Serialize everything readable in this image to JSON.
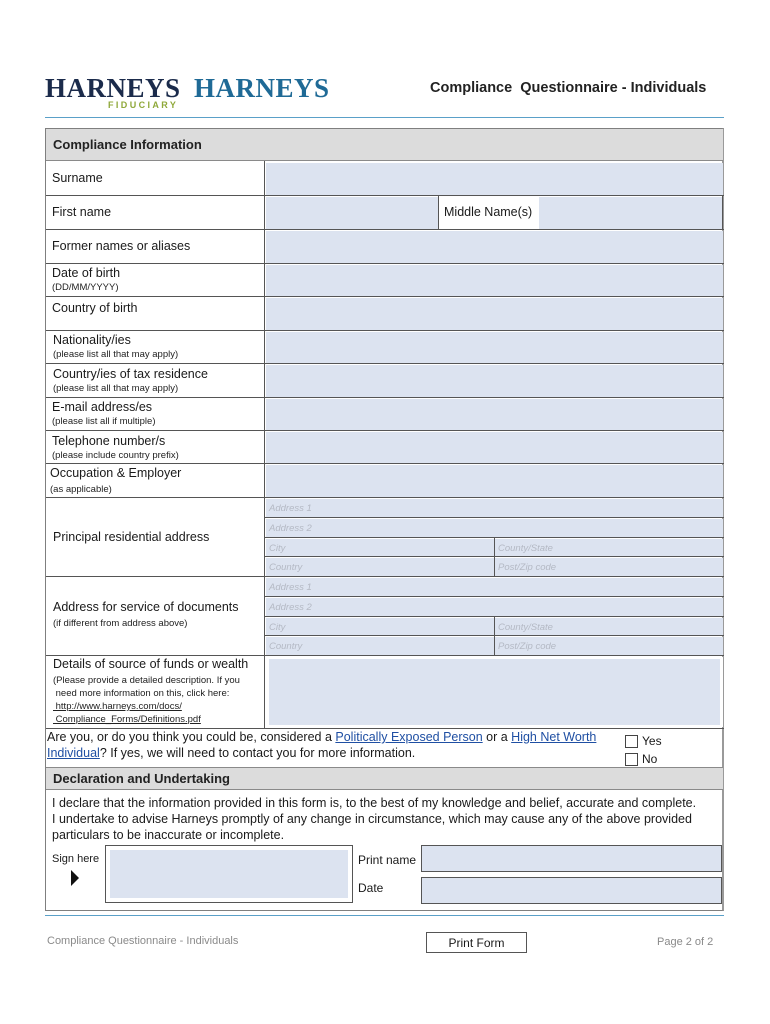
{
  "header": {
    "logo_primary": "HARNEYS",
    "logo_primary_sub": "FIDUCIARY",
    "logo_secondary": "HARNEYS",
    "title": "Compliance  Questionnaire - Individuals"
  },
  "colors": {
    "logo_navy": "#1b2b4b",
    "logo_blue": "#1f6a96",
    "logo_green": "#8fa83a",
    "rule_blue": "#5aa0c8",
    "field_fill": "#dce3f0",
    "section_fill": "#dcdcdc",
    "link_blue": "#1f4fa3"
  },
  "compliance": {
    "heading": "Compliance Information",
    "surname": {
      "label": "Surname",
      "value": ""
    },
    "first_name": {
      "label": "First name",
      "value": ""
    },
    "middle_names": {
      "label": "Middle Name(s)",
      "value": ""
    },
    "former_names": {
      "label": "Former names or aliases",
      "value": ""
    },
    "dob": {
      "label": "Date of birth",
      "hint": "(DD/MM/YYYY)",
      "value": ""
    },
    "country_birth": {
      "label": "Country of birth",
      "value": ""
    },
    "nationality": {
      "label": "Nationality/ies",
      "hint": "(please list all that may apply)",
      "value": ""
    },
    "tax_residence": {
      "label": "Country/ies of tax residence",
      "hint": "(please list all that may apply)",
      "value": ""
    },
    "email": {
      "label": "E-mail address/es",
      "hint": "(please list all if multiple)",
      "value": ""
    },
    "telephone": {
      "label": "Telephone number/s",
      "hint": "(please include country prefix)",
      "value": ""
    },
    "occupation": {
      "label": "Occupation & Employer",
      "hint": "(as applicable)",
      "value": ""
    },
    "residential_address": {
      "label": "Principal residential address",
      "placeholders": {
        "address1": "Address 1",
        "address2": "Address 2",
        "city": "City",
        "county": "County/State",
        "country": "Country",
        "postcode": "Post/Zip code"
      }
    },
    "service_address": {
      "label": "Address for service of documents",
      "hint": "(if different from address above)",
      "placeholders": {
        "address1": "Address 1",
        "address2": "Address 2",
        "city": "City",
        "county": "County/State",
        "country": "Country",
        "postcode": "Post/Zip code"
      }
    },
    "source_funds": {
      "label": "Details of source of funds or wealth",
      "hint_line1": "(Please provide a detailed description. If you",
      "hint_line2": " need more information on this, click here:",
      "link_line1": " http://www.harneys.com/docs/",
      "link_line2": " Compliance_Forms/Definitions.pdf",
      "value": ""
    },
    "pep_question": {
      "text_before": "Are you, or do you think you could be, considered a ",
      "link_pep": "Politically Exposed Person",
      "text_mid": " or a ",
      "link_hnwi_1": "High Net Worth",
      "link_hnwi_2": "Individual",
      "text_after": "? If yes, we will need to contact you for more information.",
      "options": [
        {
          "label": "Yes",
          "checked": false
        },
        {
          "label": "No",
          "checked": false
        }
      ]
    }
  },
  "declaration": {
    "heading": "Declaration and Undertaking",
    "line1": "I declare that the information provided in this form is, to the best of my knowledge and belief, accurate and complete.",
    "line2": "I undertake to advise Harneys promptly of any change in circumstance, which may cause any of the above provided",
    "line3": "particulars to be inaccurate or incomplete.",
    "sign_label": "Sign here",
    "print_name_label": "Print name",
    "print_name_value": "",
    "date_label": "Date",
    "date_value": ""
  },
  "footer": {
    "left": "Compliance Questionnaire - Individuals",
    "print_button": "Print Form",
    "page": "Page 2 of 2"
  }
}
